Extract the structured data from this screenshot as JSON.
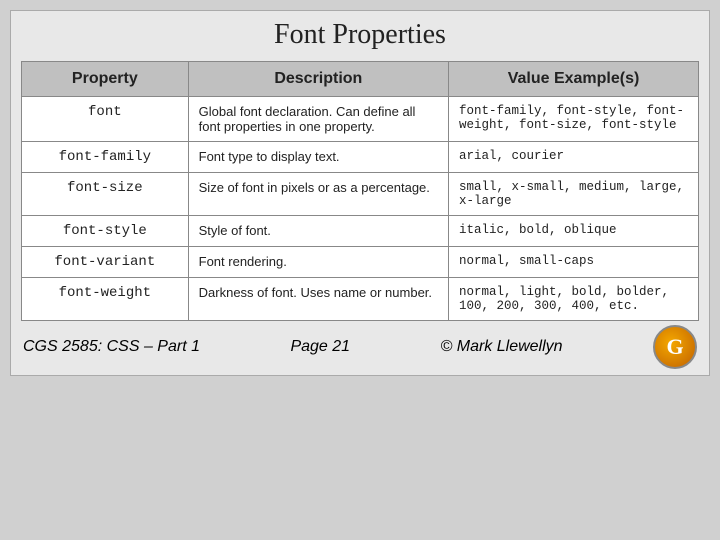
{
  "page": {
    "title": "Font Properties",
    "table": {
      "headers": [
        "Property",
        "Description",
        "Value Example(s)"
      ],
      "rows": [
        {
          "property": "font",
          "description": "Global font declaration.  Can define all font properties in one property.",
          "value": "font-family, font-style, font-weight, font-size, font-style"
        },
        {
          "property": "font-family",
          "description": "Font type to display text.",
          "value": "arial, courier"
        },
        {
          "property": "font-size",
          "description": "Size of font in pixels or as a percentage.",
          "value": "small, x-small, medium, large, x-large"
        },
        {
          "property": "font-style",
          "description": "Style of font.",
          "value": "italic, bold, oblique"
        },
        {
          "property": "font-variant",
          "description": "Font rendering.",
          "value": "normal, small-caps"
        },
        {
          "property": "font-weight",
          "description": "Darkness of font.  Uses name or number.",
          "value": "normal, light, bold, bolder, 100, 200, 300, 400, etc."
        }
      ]
    },
    "footer": {
      "left": "CGS 2585: CSS – Part 1",
      "center": "Page 21",
      "right": "© Mark Llewellyn",
      "logo": "G"
    }
  }
}
